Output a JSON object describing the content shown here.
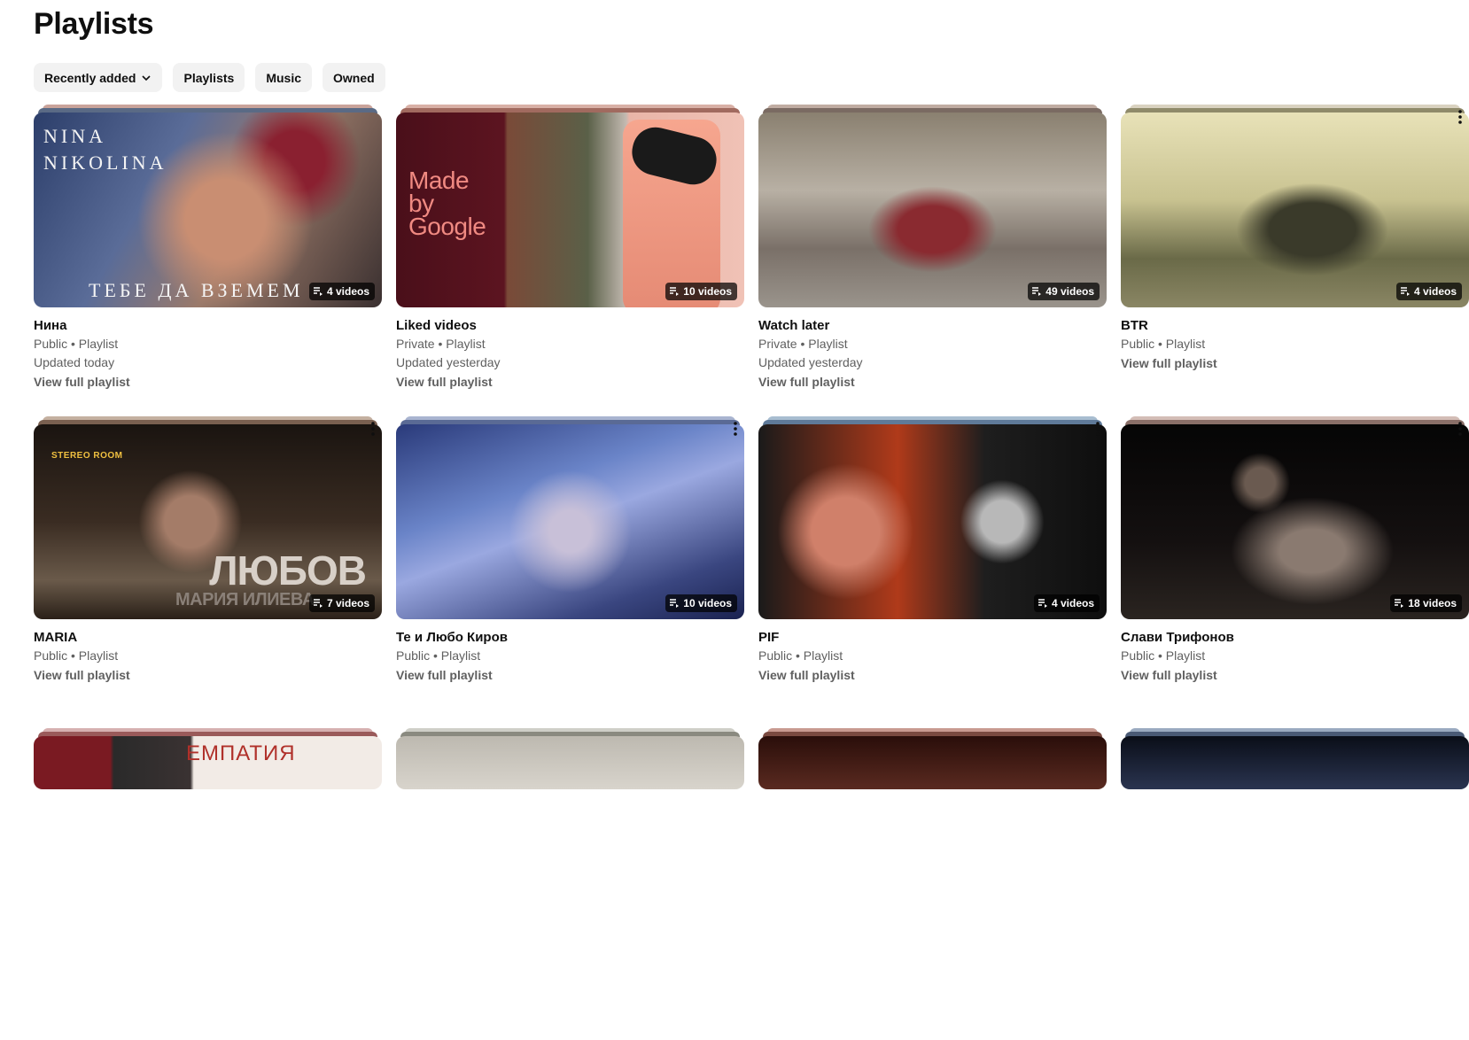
{
  "page": {
    "title": "Playlists"
  },
  "filters": {
    "sort_label": "Recently added",
    "chips": [
      "Playlists",
      "Music",
      "Owned"
    ]
  },
  "view_label": "View full playlist",
  "playlists": [
    {
      "title": "Нина",
      "visibility": "Public • Playlist",
      "updated": "Updated today",
      "count": "4 videos",
      "thumb_text_top": "NINA NIKOLINA",
      "thumb_text_bottom": "ТЕБЕ ДА ВЗЕМЕМ",
      "colors": [
        "#5a6a85",
        "#c9a39a"
      ]
    },
    {
      "title": "Liked videos",
      "visibility": "Private • Playlist",
      "updated": "Updated yesterday",
      "count": "10 videos",
      "thumb_text": "Made by Google",
      "colors": [
        "#a16a5f",
        "#d8b0a6"
      ]
    },
    {
      "title": "Watch later",
      "visibility": "Private • Playlist",
      "updated": "Updated yesterday",
      "count": "49 videos",
      "colors": [
        "#7a6a62",
        "#c0aca2"
      ]
    },
    {
      "title": "BTR",
      "visibility": "Public • Playlist",
      "updated": "",
      "count": "4 videos",
      "colors": [
        "#8f8a6a",
        "#d9d2c0"
      ]
    },
    {
      "title": "MARIA",
      "visibility": "Public • Playlist",
      "updated": "",
      "count": "7 videos",
      "thumb_text_top": "STEREO ROOM",
      "thumb_text_bottom": "ЛЮБОВ",
      "thumb_text_sub": "МАРИЯ ИЛИЕВА",
      "colors": [
        "#7a6050",
        "#c4b0a0"
      ]
    },
    {
      "title": "Те и Любо Киров",
      "visibility": "Public • Playlist",
      "updated": "",
      "count": "10 videos",
      "colors": [
        "#5a6a95",
        "#a9b4d0"
      ]
    },
    {
      "title": "PIF",
      "visibility": "Public • Playlist",
      "updated": "",
      "count": "4 videos",
      "colors": [
        "#5f7a99",
        "#a8bdd0"
      ]
    },
    {
      "title": "Слави Трифонов",
      "visibility": "Public • Playlist",
      "updated": "",
      "count": "18 videos",
      "colors": [
        "#8a6f68",
        "#d3bdb6"
      ]
    },
    {
      "thumb_text": "ЕМПАТИЯ",
      "colors": [
        "#9a5a5a",
        "#d6b0b0"
      ]
    },
    {
      "colors": [
        "#8a8a80",
        "#cfcfc8"
      ]
    },
    {
      "colors": [
        "#7a4a40",
        "#c89a90"
      ]
    },
    {
      "colors": [
        "#4a5a75",
        "#9aaac0"
      ]
    }
  ]
}
